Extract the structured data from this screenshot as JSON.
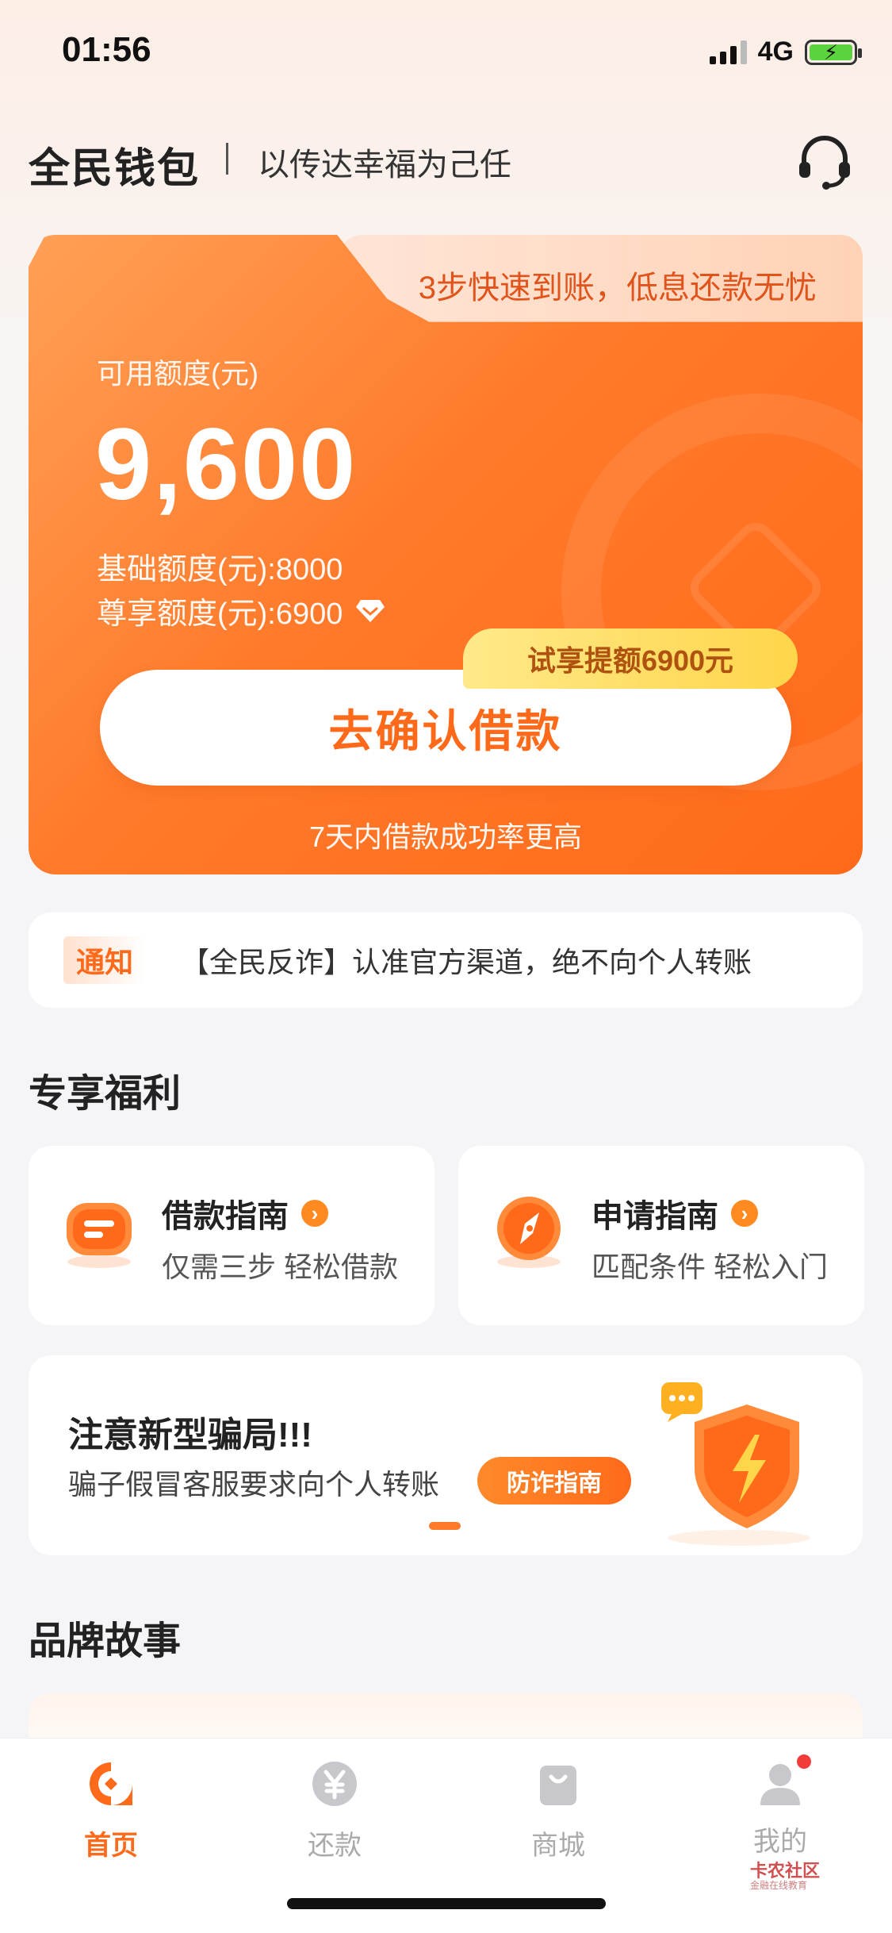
{
  "status_bar": {
    "time": "01:56",
    "network": "4G"
  },
  "header": {
    "brand": "全民钱包",
    "slogan": "以传达幸福为己任",
    "support_icon": "headset-icon"
  },
  "credit_card": {
    "tab_text": "3步快速到账，低息还款无忧",
    "quota_label": "可用额度(元)",
    "quota_amount": "9,600",
    "basic_quota": "基础额度(元):8000",
    "vip_quota": "尊享额度(元):6900",
    "trial_badge": "试享提额6900元",
    "confirm_button": "去确认借款",
    "success_tip": "7天内借款成功率更高",
    "colors": {
      "primary": "#ff6a1a",
      "gradient_start": "#ffa056",
      "badge": "#ffd54a"
    }
  },
  "notice": {
    "tag": "通知",
    "text": "【全民反诈】认准官方渠道，绝不向个人转账"
  },
  "benefits": {
    "title": "专享福利",
    "items": [
      {
        "title": "借款指南",
        "subtitle": "仅需三步 轻松借款",
        "icon": "guide-icon"
      },
      {
        "title": "申请指南",
        "subtitle": "匹配条件 轻松入门",
        "icon": "compass-icon"
      }
    ]
  },
  "fraud_banner": {
    "title": "注意新型骗局!!!",
    "subtitle": "骗子假冒客服要求向个人转账",
    "button": "防诈指南",
    "icon": "shield-icon"
  },
  "brand_story": {
    "title": "品牌故事"
  },
  "tabbar": {
    "items": [
      {
        "label": "首页",
        "icon": "home-icon",
        "active": true
      },
      {
        "label": "还款",
        "icon": "yuan-icon",
        "active": false
      },
      {
        "label": "商城",
        "icon": "shopping-bag-icon",
        "active": false
      },
      {
        "label": "我的",
        "icon": "user-icon",
        "active": false,
        "badge": true
      }
    ]
  },
  "watermark": {
    "title": "卡农社区",
    "subtitle": "金融在线教育"
  }
}
